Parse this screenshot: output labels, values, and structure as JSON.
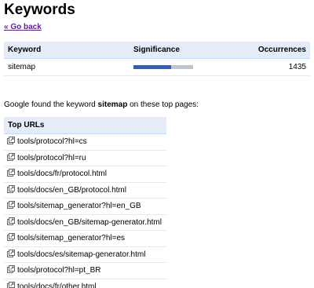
{
  "page": {
    "title": "Keywords",
    "back_link": "« Go back"
  },
  "keywords_table": {
    "headers": {
      "keyword": "Keyword",
      "significance": "Significance",
      "occurrences": "Occurrences"
    },
    "rows": [
      {
        "keyword": "sitemap",
        "significance": 0.63,
        "occurrences": "1435"
      }
    ]
  },
  "found": {
    "prefix": "Google found the keyword",
    "keyword": "sitemap",
    "suffix": "on these top pages:"
  },
  "urls_table": {
    "header": "Top URLs",
    "items": [
      "tools/protocol?hl=cs",
      "tools/protocol?hl=ru",
      "tools/docs/fr/protocol.html",
      "tools/docs/en_GB/protocol.html",
      "tools/sitemap_generator?hl=en_GB",
      "tools/docs/en_GB/sitemap-generator.html",
      "tools/sitemap_generator?hl=es",
      "tools/docs/es/sitemap-generator.html",
      "tools/protocol?hl=pt_BR",
      "tools/docs/fr/other.html"
    ]
  },
  "colors": {
    "header_bg": "#e5ecf9",
    "bar_fill": "#2b5fbd",
    "bar_bg": "#bcc4d4",
    "link": "#6020a0"
  },
  "icons": {
    "url_icon": "external-link-icon"
  }
}
